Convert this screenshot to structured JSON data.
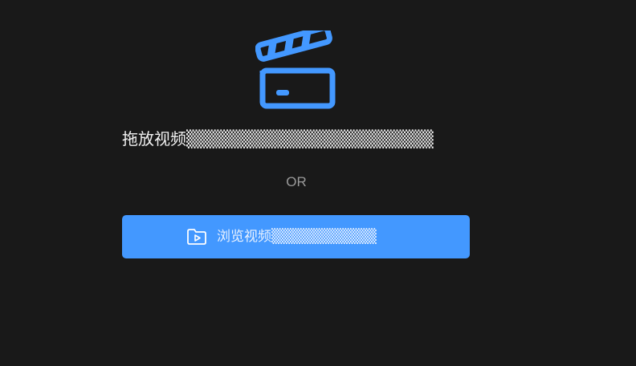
{
  "dropzone": {
    "icon": "clapperboard-icon",
    "drop_label": "拖放视频▒▒▒▒▒▒▒▒▒▒▒▒▒▒▒▒▒▒▒▒",
    "or_label": "OR",
    "browse_button": {
      "icon": "folder-video-icon",
      "label": "浏览视频▒▒▒▒▒▒▒▒▒▒"
    }
  },
  "colors": {
    "background": "#191919",
    "accent": "#4398ff",
    "text_primary": "#f2f2f2",
    "text_secondary": "#9a9a9a"
  }
}
